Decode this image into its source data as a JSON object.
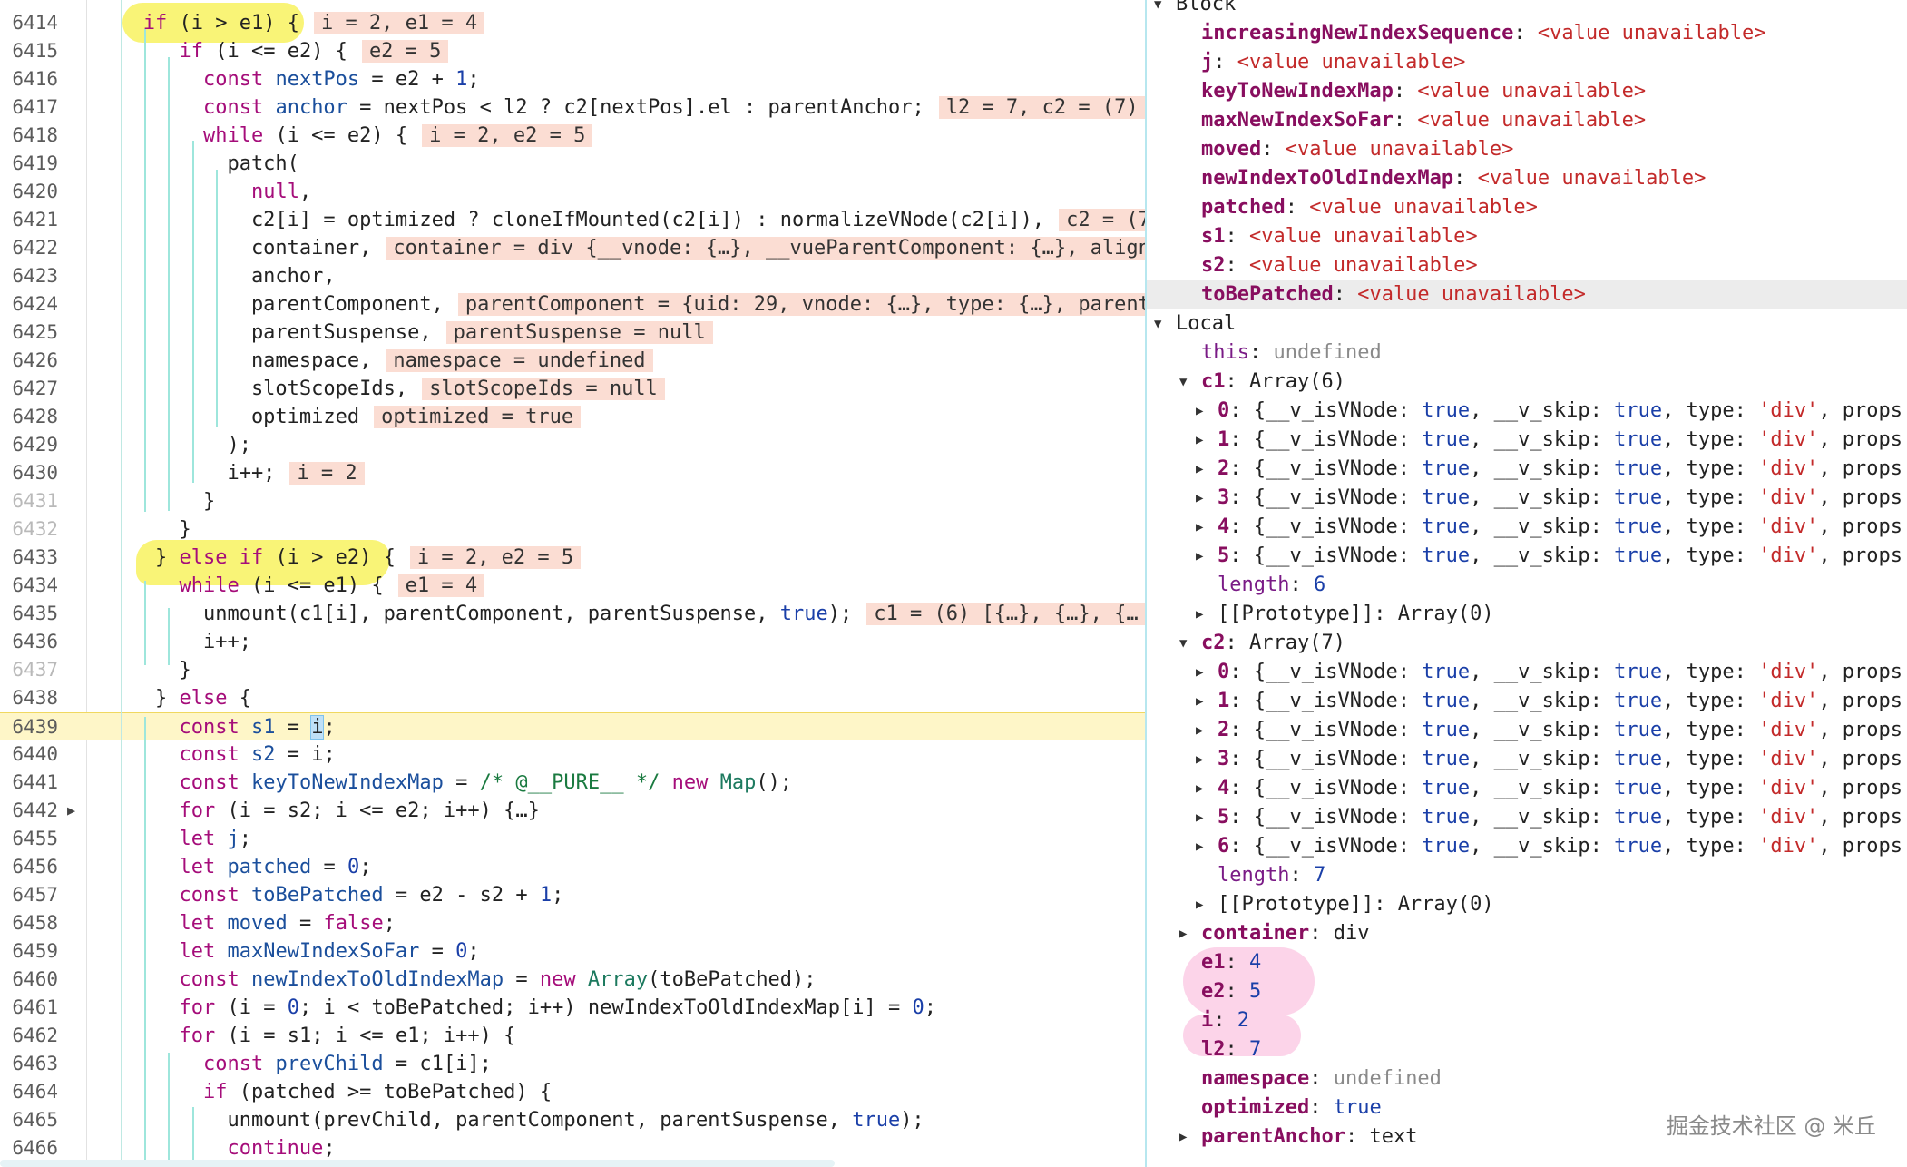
{
  "code_lines": [
    {
      "num": "6414",
      "parts": [
        [
          "   ",
          ""
        ],
        [
          "if",
          "kw"
        ],
        [
          " (i > e1) {",
          ""
        ]
      ],
      "inline": "i = 2, e1 = 4"
    },
    {
      "num": "6415",
      "parts": [
        [
          "      ",
          ""
        ],
        [
          "if",
          "kw"
        ],
        [
          " (i <= e2) {",
          ""
        ]
      ],
      "inline": "e2 = 5"
    },
    {
      "num": "6416",
      "parts": [
        [
          "        ",
          ""
        ],
        [
          "const",
          "kw"
        ],
        [
          " ",
          ""
        ],
        [
          "nextPos",
          "fn"
        ],
        [
          " = e2 + ",
          ""
        ],
        [
          "1",
          "nm"
        ],
        [
          ";",
          ""
        ]
      ]
    },
    {
      "num": "6417",
      "parts": [
        [
          "        ",
          ""
        ],
        [
          "const",
          "kw"
        ],
        [
          " ",
          ""
        ],
        [
          "anchor",
          "fn"
        ],
        [
          " = nextPos < l2 ? c2[nextPos].el : parentAnchor;",
          ""
        ]
      ],
      "inline": "l2 = 7, c2 = (7)"
    },
    {
      "num": "6418",
      "parts": [
        [
          "        ",
          ""
        ],
        [
          "while",
          "kw"
        ],
        [
          " (i <= e2) {",
          ""
        ]
      ],
      "inline": "i = 2, e2 = 5"
    },
    {
      "num": "6419",
      "parts": [
        [
          "          patch(",
          ""
        ]
      ]
    },
    {
      "num": "6420",
      "parts": [
        [
          "            ",
          ""
        ],
        [
          "null",
          "kw"
        ],
        [
          ",",
          ""
        ]
      ]
    },
    {
      "num": "6421",
      "parts": [
        [
          "            c2[i] = optimized ? cloneIfMounted(c2[i]) : normalizeVNode(c2[i]),",
          ""
        ]
      ],
      "inline": "c2 = (7"
    },
    {
      "num": "6422",
      "parts": [
        [
          "            container,",
          ""
        ]
      ],
      "inline": "container = div {__vnode: {…}, __vueParentComponent: {…}, align"
    },
    {
      "num": "6423",
      "parts": [
        [
          "            anchor,",
          ""
        ]
      ]
    },
    {
      "num": "6424",
      "parts": [
        [
          "            parentComponent,",
          ""
        ]
      ],
      "inline": "parentComponent = {uid: 29, vnode: {…}, type: {…}, parent"
    },
    {
      "num": "6425",
      "parts": [
        [
          "            parentSuspense,",
          ""
        ]
      ],
      "inline": "parentSuspense = null"
    },
    {
      "num": "6426",
      "parts": [
        [
          "            namespace,",
          ""
        ]
      ],
      "inline": "namespace = undefined"
    },
    {
      "num": "6427",
      "parts": [
        [
          "            slotScopeIds,",
          ""
        ]
      ],
      "inline": "slotScopeIds = null"
    },
    {
      "num": "6428",
      "parts": [
        [
          "            optimized",
          ""
        ]
      ],
      "inline": "optimized = true"
    },
    {
      "num": "6429",
      "parts": [
        [
          "          );",
          ""
        ]
      ]
    },
    {
      "num": "6430",
      "parts": [
        [
          "          i++;",
          ""
        ]
      ],
      "inline": "i = 2"
    },
    {
      "num": "6431",
      "dim": true,
      "parts": [
        [
          "        }",
          ""
        ]
      ]
    },
    {
      "num": "6432",
      "dim": true,
      "parts": [
        [
          "      }",
          ""
        ]
      ]
    },
    {
      "num": "6433",
      "parts": [
        [
          "    } ",
          ""
        ],
        [
          "else if",
          "kw"
        ],
        [
          " (i > e2) {",
          ""
        ]
      ],
      "inline": "i = 2, e2 = 5"
    },
    {
      "num": "6434",
      "parts": [
        [
          "      ",
          ""
        ],
        [
          "while",
          "kw"
        ],
        [
          " (i <= e1) {",
          ""
        ]
      ],
      "inline": "e1 = 4"
    },
    {
      "num": "6435",
      "parts": [
        [
          "        unmount(c1[i], parentComponent, parentSuspense, ",
          ""
        ],
        [
          "true",
          "nm"
        ],
        [
          ");",
          ""
        ]
      ],
      "inline": "c1 = (6) [{…}, {…}, {…"
    },
    {
      "num": "6436",
      "parts": [
        [
          "        i++;",
          ""
        ]
      ]
    },
    {
      "num": "6437",
      "dim": true,
      "parts": [
        [
          "      }",
          ""
        ]
      ]
    },
    {
      "num": "6438",
      "parts": [
        [
          "    } ",
          ""
        ],
        [
          "else",
          "kw"
        ],
        [
          " {",
          ""
        ]
      ]
    },
    {
      "num": "6439",
      "cur": true,
      "parts": [
        [
          "      ",
          ""
        ],
        [
          "const",
          "kw"
        ],
        [
          " ",
          ""
        ],
        [
          "s1",
          "fn"
        ],
        [
          " = ",
          ""
        ],
        [
          "i",
          "sel"
        ],
        [
          ";",
          ""
        ]
      ]
    },
    {
      "num": "6440",
      "parts": [
        [
          "      ",
          ""
        ],
        [
          "const",
          "kw"
        ],
        [
          " ",
          ""
        ],
        [
          "s2",
          "fn"
        ],
        [
          " = i;",
          ""
        ]
      ]
    },
    {
      "num": "6441",
      "parts": [
        [
          "      ",
          ""
        ],
        [
          "const",
          "kw"
        ],
        [
          " ",
          ""
        ],
        [
          "keyToNewIndexMap",
          "fn"
        ],
        [
          " = ",
          ""
        ],
        [
          "/* @__PURE__ */",
          "cm"
        ],
        [
          " ",
          ""
        ],
        [
          "new",
          "kw"
        ],
        [
          " ",
          ""
        ],
        [
          "Map",
          "gl"
        ],
        [
          "();",
          ""
        ]
      ]
    },
    {
      "num": "6442",
      "fold": true,
      "parts": [
        [
          "      ",
          ""
        ],
        [
          "for",
          "kw"
        ],
        [
          " (i = s2; i <= e2; i++) {…}",
          ""
        ]
      ]
    },
    {
      "num": "6455",
      "parts": [
        [
          "      ",
          ""
        ],
        [
          "let",
          "kw"
        ],
        [
          " ",
          ""
        ],
        [
          "j",
          "fn"
        ],
        [
          ";",
          ""
        ]
      ]
    },
    {
      "num": "6456",
      "parts": [
        [
          "      ",
          ""
        ],
        [
          "let",
          "kw"
        ],
        [
          " ",
          ""
        ],
        [
          "patched",
          "fn"
        ],
        [
          " = ",
          ""
        ],
        [
          "0",
          "nm"
        ],
        [
          ";",
          ""
        ]
      ]
    },
    {
      "num": "6457",
      "parts": [
        [
          "      ",
          ""
        ],
        [
          "const",
          "kw"
        ],
        [
          " ",
          ""
        ],
        [
          "toBePatched",
          "fn"
        ],
        [
          " = e2 - s2 + ",
          ""
        ],
        [
          "1",
          "nm"
        ],
        [
          ";",
          ""
        ]
      ]
    },
    {
      "num": "6458",
      "parts": [
        [
          "      ",
          ""
        ],
        [
          "let",
          "kw"
        ],
        [
          " ",
          ""
        ],
        [
          "moved",
          "fn"
        ],
        [
          " = ",
          ""
        ],
        [
          "false",
          "kw"
        ],
        [
          ";",
          ""
        ]
      ]
    },
    {
      "num": "6459",
      "parts": [
        [
          "      ",
          ""
        ],
        [
          "let",
          "kw"
        ],
        [
          " ",
          ""
        ],
        [
          "maxNewIndexSoFar",
          "fn"
        ],
        [
          " = ",
          ""
        ],
        [
          "0",
          "nm"
        ],
        [
          ";",
          ""
        ]
      ]
    },
    {
      "num": "6460",
      "parts": [
        [
          "      ",
          ""
        ],
        [
          "const",
          "kw"
        ],
        [
          " ",
          ""
        ],
        [
          "newIndexToOldIndexMap",
          "fn"
        ],
        [
          " = ",
          ""
        ],
        [
          "new",
          "kw"
        ],
        [
          " ",
          ""
        ],
        [
          "Array",
          "gl"
        ],
        [
          "(toBePatched);",
          ""
        ]
      ]
    },
    {
      "num": "6461",
      "parts": [
        [
          "      ",
          ""
        ],
        [
          "for",
          "kw"
        ],
        [
          " (i = ",
          ""
        ],
        [
          "0",
          "nm"
        ],
        [
          "; i < toBePatched; i++) newIndexToOldIndexMap[i] = ",
          ""
        ],
        [
          "0",
          "nm"
        ],
        [
          ";",
          ""
        ]
      ]
    },
    {
      "num": "6462",
      "parts": [
        [
          "      ",
          ""
        ],
        [
          "for",
          "kw"
        ],
        [
          " (i = s1; i <= e1; i++) {",
          ""
        ]
      ]
    },
    {
      "num": "6463",
      "parts": [
        [
          "        ",
          ""
        ],
        [
          "const",
          "kw"
        ],
        [
          " ",
          ""
        ],
        [
          "prevChild",
          "fn"
        ],
        [
          " = c1[i];",
          ""
        ]
      ]
    },
    {
      "num": "6464",
      "parts": [
        [
          "        ",
          ""
        ],
        [
          "if",
          "kw"
        ],
        [
          " (patched >= toBePatched) {",
          ""
        ]
      ]
    },
    {
      "num": "6465",
      "parts": [
        [
          "          unmount(prevChild, parentComponent, parentSuspense, ",
          ""
        ],
        [
          "true",
          "nm"
        ],
        [
          ");",
          ""
        ]
      ]
    },
    {
      "num": "6466",
      "parts": [
        [
          "          ",
          ""
        ],
        [
          "continue",
          "kw"
        ],
        [
          ";",
          ""
        ]
      ]
    }
  ],
  "scope": {
    "block_title": "Block",
    "block_vars": [
      {
        "name": "increasingNewIndexSequence",
        "value": "<value unavailable>"
      },
      {
        "name": "j",
        "value": "<value unavailable>"
      },
      {
        "name": "keyToNewIndexMap",
        "value": "<value unavailable>"
      },
      {
        "name": "maxNewIndexSoFar",
        "value": "<value unavailable>"
      },
      {
        "name": "moved",
        "value": "<value unavailable>"
      },
      {
        "name": "newIndexToOldIndexMap",
        "value": "<value unavailable>"
      },
      {
        "name": "patched",
        "value": "<value unavailable>"
      },
      {
        "name": "s1",
        "value": "<value unavailable>"
      },
      {
        "name": "s2",
        "value": "<value unavailable>"
      },
      {
        "name": "toBePatched",
        "value": "<value unavailable>"
      }
    ],
    "local_title": "Local",
    "this_label": "this",
    "this_value": "undefined",
    "c1_label": "c1",
    "c1_value": "Array(6)",
    "c2_label": "c2",
    "c2_value": "Array(7)",
    "vnode_text": "{__v_isVNode: true, __v_skip: true, type: 'div', props",
    "c1_items": [
      "0",
      "1",
      "2",
      "3",
      "4",
      "5"
    ],
    "c2_items": [
      "0",
      "1",
      "2",
      "3",
      "4",
      "5",
      "6"
    ],
    "c1_length": "6",
    "c2_length": "7",
    "proto_label": "[[Prototype]]",
    "proto_value": "Array(0)",
    "length_label": "length",
    "container_label": "container",
    "container_value": "div",
    "e1": "4",
    "e2": "5",
    "i": "2",
    "l2": "7",
    "namespace_label": "namespace",
    "namespace_value": "undefined",
    "optimized_label": "optimized",
    "optimized_value": "true",
    "parentAnchor_label": "parentAnchor",
    "parentAnchor_value": "text"
  },
  "watermark": "掘金技术社区 @ 米丘",
  "colors": {
    "highlight_yellow": "#f7f04a",
    "highlight_pink": "#fbc6e2",
    "inline_value_bg": "#fbddd3",
    "current_line": "#fef6c8"
  }
}
